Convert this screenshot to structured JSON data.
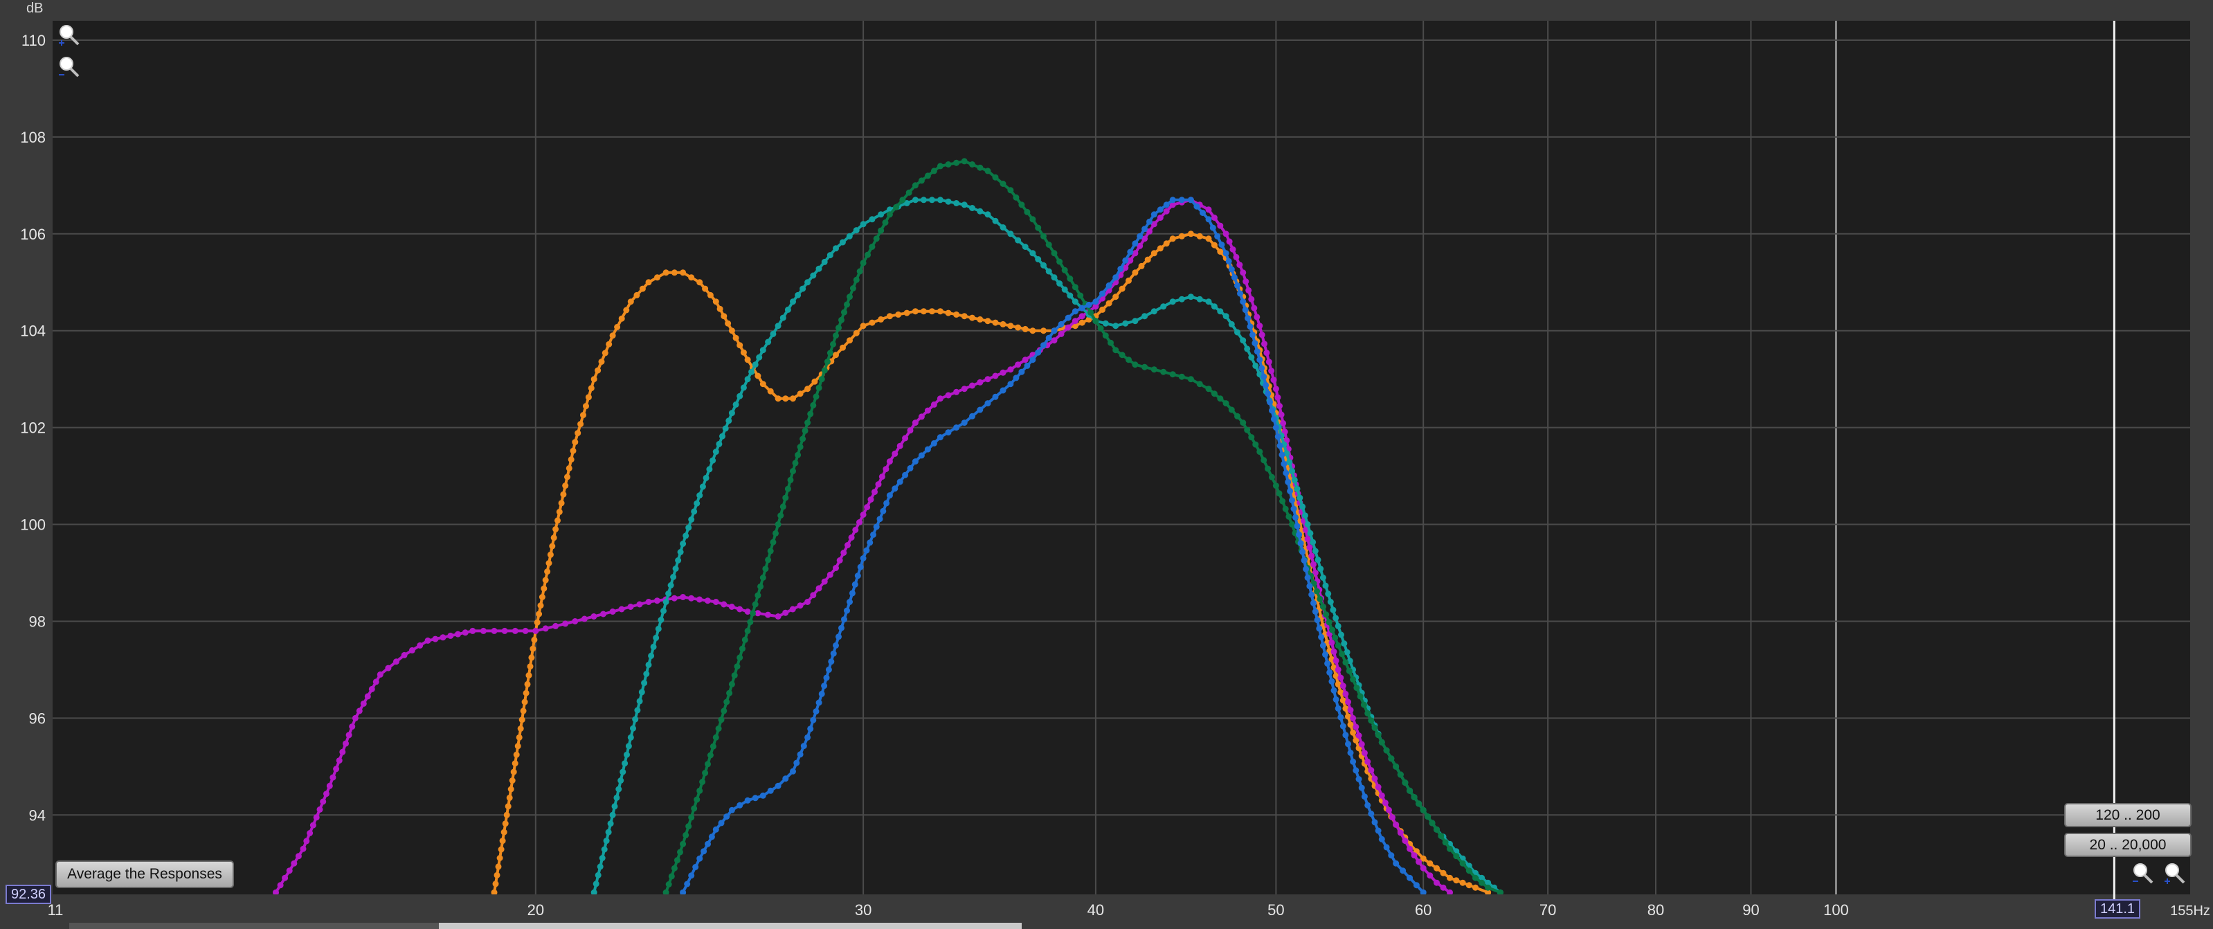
{
  "y_unit": "dB",
  "x_unit": "Hz",
  "buttons": {
    "average": "Average the Responses",
    "range_1": "120 .. 200",
    "range_2": "20 .. 20,000"
  },
  "readouts": {
    "y_min": "92.36",
    "x_max": "141.1"
  },
  "icons": [
    "zoom-in-icon",
    "zoom-out-icon",
    "zoom-out-icon",
    "zoom-in-icon"
  ],
  "colors": {
    "background": "#3a3a3a",
    "plot_bg": "#1e1e1e",
    "grid": "#4a4a4a",
    "orange": "#f08c1e",
    "purple": "#b418c8",
    "teal": "#12a0a0",
    "green": "#0a7846",
    "blue": "#1e6ed2"
  },
  "chart_data": {
    "type": "line",
    "title": "",
    "xlabel": "Hz",
    "ylabel": "dB",
    "x_scale": "log",
    "xlim": [
      11,
      155
    ],
    "ylim": [
      92.36,
      110.4
    ],
    "x_ticks": [
      11,
      20,
      30,
      40,
      50,
      60,
      70,
      80,
      90,
      100,
      141.1,
      155
    ],
    "x_tick_labels": [
      "11",
      "20",
      "30",
      "40",
      "50",
      "60",
      "70",
      "80",
      "90",
      "100",
      "141.1",
      "155Hz"
    ],
    "y_ticks": [
      94,
      96,
      98,
      100,
      102,
      104,
      106,
      108,
      110
    ],
    "grid": true,
    "legend": "none",
    "cursor_x": 141.1,
    "series": [
      {
        "color": "#f08c1e",
        "x": [
          19.0,
          19.3,
          19.6,
          20.0,
          20.5,
          21.0,
          21.5,
          22.0,
          22.5,
          23.0,
          23.5,
          24.0,
          24.5,
          25.0,
          25.5,
          26.0,
          26.5,
          27.0,
          27.5,
          28.0,
          28.5,
          29.0,
          29.5,
          30.0,
          31.0,
          32.0,
          33.0,
          34.0,
          35.0,
          36.0,
          37.0,
          38.0,
          39.0,
          40.0,
          41.0,
          42.0,
          43.0,
          44.0,
          45.0,
          46.0,
          47.0,
          48.0,
          49.0,
          50.0,
          51.0,
          52.0,
          53.0,
          54.0,
          55.0,
          56.0,
          57.0,
          58.0,
          59.0,
          60.0,
          61.0,
          62.0,
          63.0,
          64.0,
          65.0
        ],
        "y": [
          92.4,
          94.0,
          95.6,
          97.8,
          99.9,
          101.7,
          103.0,
          103.9,
          104.6,
          105.0,
          105.2,
          105.2,
          105.0,
          104.6,
          104.0,
          103.4,
          102.9,
          102.6,
          102.6,
          102.8,
          103.1,
          103.5,
          103.8,
          104.1,
          104.3,
          104.4,
          104.4,
          104.3,
          104.2,
          104.1,
          104.0,
          104.0,
          104.1,
          104.3,
          104.7,
          105.2,
          105.6,
          105.9,
          106.0,
          105.9,
          105.5,
          104.7,
          103.6,
          102.3,
          100.8,
          99.3,
          97.9,
          96.7,
          95.7,
          94.9,
          94.3,
          93.8,
          93.4,
          93.1,
          92.9,
          92.7,
          92.6,
          92.5,
          92.4
        ]
      },
      {
        "color": "#b418c8",
        "x": [
          14.5,
          15.0,
          15.5,
          16.0,
          16.5,
          17.0,
          17.5,
          18.0,
          18.5,
          19.0,
          19.5,
          20.0,
          20.5,
          21.0,
          22.0,
          23.0,
          24.0,
          25.0,
          26.0,
          27.0,
          28.0,
          29.0,
          30.0,
          31.0,
          32.0,
          33.0,
          34.0,
          35.0,
          36.0,
          37.0,
          38.0,
          39.0,
          40.0,
          41.0,
          42.0,
          43.0,
          44.0,
          45.0,
          46.0,
          47.0,
          48.0,
          49.0,
          50.0,
          51.0,
          52.0,
          53.0,
          54.0,
          55.0,
          56.0,
          57.0,
          58.0,
          59.0,
          60.0,
          61.0,
          62.0
        ],
        "y": [
          92.4,
          93.3,
          94.6,
          96.0,
          96.9,
          97.3,
          97.6,
          97.7,
          97.8,
          97.8,
          97.8,
          97.8,
          97.9,
          98.0,
          98.2,
          98.4,
          98.5,
          98.4,
          98.2,
          98.1,
          98.4,
          99.1,
          100.2,
          101.3,
          102.1,
          102.6,
          102.8,
          103.0,
          103.2,
          103.5,
          103.8,
          104.2,
          104.5,
          105.0,
          105.6,
          106.2,
          106.6,
          106.7,
          106.5,
          106.0,
          105.2,
          104.1,
          102.8,
          101.2,
          99.7,
          98.3,
          97.0,
          96.0,
          95.1,
          94.4,
          93.8,
          93.3,
          92.9,
          92.6,
          92.4
        ]
      },
      {
        "color": "#12a0a0",
        "x": [
          21.5,
          22.0,
          22.5,
          23.0,
          23.5,
          24.0,
          24.5,
          25.0,
          25.5,
          26.0,
          26.5,
          27.0,
          27.5,
          28.0,
          29.0,
          30.0,
          31.0,
          32.0,
          33.0,
          34.0,
          35.0,
          36.0,
          37.0,
          38.0,
          39.0,
          40.0,
          41.0,
          42.0,
          43.0,
          44.0,
          45.0,
          46.0,
          47.0,
          48.0,
          49.0,
          50.0,
          51.0,
          52.0,
          53.0,
          54.0,
          55.0,
          56.0,
          57.0,
          58.0,
          59.0,
          60.0,
          61.0,
          62.0,
          63.0,
          64.0,
          65.0,
          66.0
        ],
        "y": [
          92.4,
          94.0,
          95.6,
          97.1,
          98.4,
          99.6,
          100.6,
          101.5,
          102.3,
          103.0,
          103.6,
          104.1,
          104.6,
          105.0,
          105.7,
          106.2,
          106.5,
          106.7,
          106.7,
          106.6,
          106.4,
          106.0,
          105.6,
          105.1,
          104.6,
          104.2,
          104.1,
          104.2,
          104.4,
          104.6,
          104.7,
          104.6,
          104.3,
          103.8,
          103.1,
          102.2,
          101.1,
          100.0,
          98.9,
          97.9,
          97.0,
          96.2,
          95.5,
          95.0,
          94.5,
          94.1,
          93.7,
          93.4,
          93.1,
          92.8,
          92.6,
          92.4
        ]
      },
      {
        "color": "#0a7846",
        "x": [
          23.5,
          24.0,
          24.5,
          25.0,
          25.5,
          26.0,
          26.5,
          27.0,
          27.5,
          28.0,
          28.5,
          29.0,
          29.5,
          30.0,
          31.0,
          32.0,
          33.0,
          34.0,
          35.0,
          36.0,
          37.0,
          38.0,
          39.0,
          40.0,
          41.0,
          42.0,
          43.0,
          44.0,
          45.0,
          46.0,
          47.0,
          48.0,
          49.0,
          50.0,
          51.0,
          52.0,
          53.0,
          54.0,
          55.0,
          56.0,
          57.0,
          58.0,
          59.0,
          60.0,
          61.0,
          62.0,
          63.0,
          64.0,
          65.0,
          66.0
        ],
        "y": [
          92.4,
          93.4,
          94.5,
          95.6,
          96.7,
          97.8,
          98.9,
          100.0,
          101.1,
          102.1,
          103.0,
          103.9,
          104.7,
          105.4,
          106.4,
          107.0,
          107.4,
          107.5,
          107.3,
          106.9,
          106.3,
          105.6,
          104.9,
          104.2,
          103.6,
          103.3,
          103.2,
          103.1,
          103.0,
          102.8,
          102.5,
          102.1,
          101.5,
          100.8,
          100.0,
          99.1,
          98.3,
          97.5,
          96.8,
          96.1,
          95.5,
          95.0,
          94.5,
          94.1,
          93.7,
          93.3,
          93.0,
          92.7,
          92.5,
          92.4
        ]
      },
      {
        "color": "#1e6ed2",
        "x": [
          24.0,
          24.5,
          25.0,
          25.5,
          26.0,
          26.5,
          27.0,
          27.5,
          28.0,
          28.5,
          29.0,
          29.5,
          30.0,
          31.0,
          32.0,
          33.0,
          34.0,
          35.0,
          36.0,
          37.0,
          38.0,
          39.0,
          40.0,
          41.0,
          42.0,
          43.0,
          44.0,
          45.0,
          46.0,
          47.0,
          48.0,
          49.0,
          50.0,
          51.0,
          52.0,
          53.0,
          54.0,
          55.0,
          56.0,
          57.0,
          58.0,
          59.0,
          60.0
        ],
        "y": [
          92.4,
          93.1,
          93.7,
          94.1,
          94.3,
          94.4,
          94.6,
          94.9,
          95.6,
          96.5,
          97.5,
          98.4,
          99.3,
          100.6,
          101.3,
          101.8,
          102.1,
          102.5,
          102.9,
          103.4,
          104.0,
          104.4,
          104.6,
          105.1,
          105.8,
          106.4,
          106.7,
          106.7,
          106.3,
          105.6,
          104.6,
          103.4,
          102.0,
          100.5,
          98.9,
          97.5,
          96.2,
          95.1,
          94.2,
          93.5,
          93.0,
          92.7,
          92.4
        ]
      }
    ]
  }
}
